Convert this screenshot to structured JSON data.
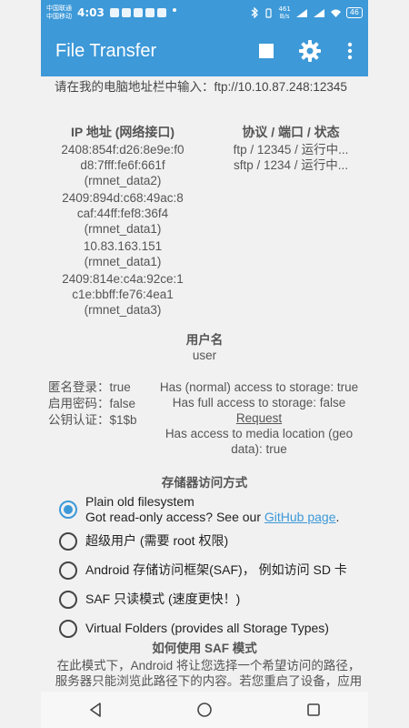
{
  "status_bar": {
    "carrier1": "中国联通",
    "carrier2": "中国移动",
    "time": "4:03",
    "speed_value": "461",
    "speed_unit": "B/s",
    "battery": "46"
  },
  "app_bar": {
    "title": "File Transfer",
    "stop_icon": "stop-square-icon",
    "settings_icon": "gear-icon",
    "menu_icon": "overflow-menu-icon"
  },
  "url_hint": "请在我的电脑地址栏中输入：ftp://10.10.87.248:12345",
  "ip_header": "IP 地址 (网络接口)",
  "protocol_header": "协议 / 端口 / 状态",
  "ip_addresses": [
    {
      "address": "2408:854f:d26:8e9e:f0d8:7fff:fe6f:661f",
      "iface": "(rmnet_data2)"
    },
    {
      "address": "2409:894d:c68:49ac:8caf:44ff:fef8:36f4",
      "iface": "(rmnet_data1)"
    },
    {
      "address": "10.83.163.151",
      "iface": "(rmnet_data1)"
    },
    {
      "address": "2409:814e:c4a:92ce:1c1e:bbff:fe76:4ea1",
      "iface": "(rmnet_data3)"
    }
  ],
  "protocols": [
    "ftp / 12345 / 运行中...",
    "sftp / 1234 / 运行中..."
  ],
  "user": {
    "title": "用户名",
    "value": "user"
  },
  "login_options": [
    {
      "label": "匿名登录：",
      "value": "true"
    },
    {
      "label": "启用密码：",
      "value": "false"
    },
    {
      "label": "公钥认证：",
      "value": "$1$b"
    }
  ],
  "access": {
    "normal": "Has (normal) access to storage: true",
    "full": "Has full access to storage: false",
    "request": "Request",
    "media": "Has access to media location (geo data): true"
  },
  "storage": {
    "title": "存储器访问方式",
    "options": [
      {
        "label": "Plain old filesystem",
        "checked": true
      },
      {
        "label": "超级用户 (需要 root 权限)",
        "checked": false
      },
      {
        "label": "Android 存储访问框架(SAF)， 例如访问 SD 卡",
        "checked": false
      },
      {
        "label": "SAF 只读模式 (速度更快！)",
        "checked": false
      },
      {
        "label": "Virtual Folders (provides all Storage Types)",
        "checked": false
      }
    ],
    "readonly_hint_prefix": "Got read-only access? See our ",
    "github_link": "GitHub page",
    "readonly_hint_suffix": "."
  },
  "saf_help": {
    "title": "如何使用 SAF 模式",
    "text": "在此模式下，Android 将让您选择一个希望访问的路径，服务器只能浏览此路径下的内容。若您重启了设备，应用"
  },
  "nav": {
    "back_icon": "back-triangle-icon",
    "home_icon": "home-circle-icon",
    "recents_icon": "recents-square-icon"
  },
  "colors": {
    "accent": "#3d99d8",
    "background": "#f1f1f1"
  }
}
